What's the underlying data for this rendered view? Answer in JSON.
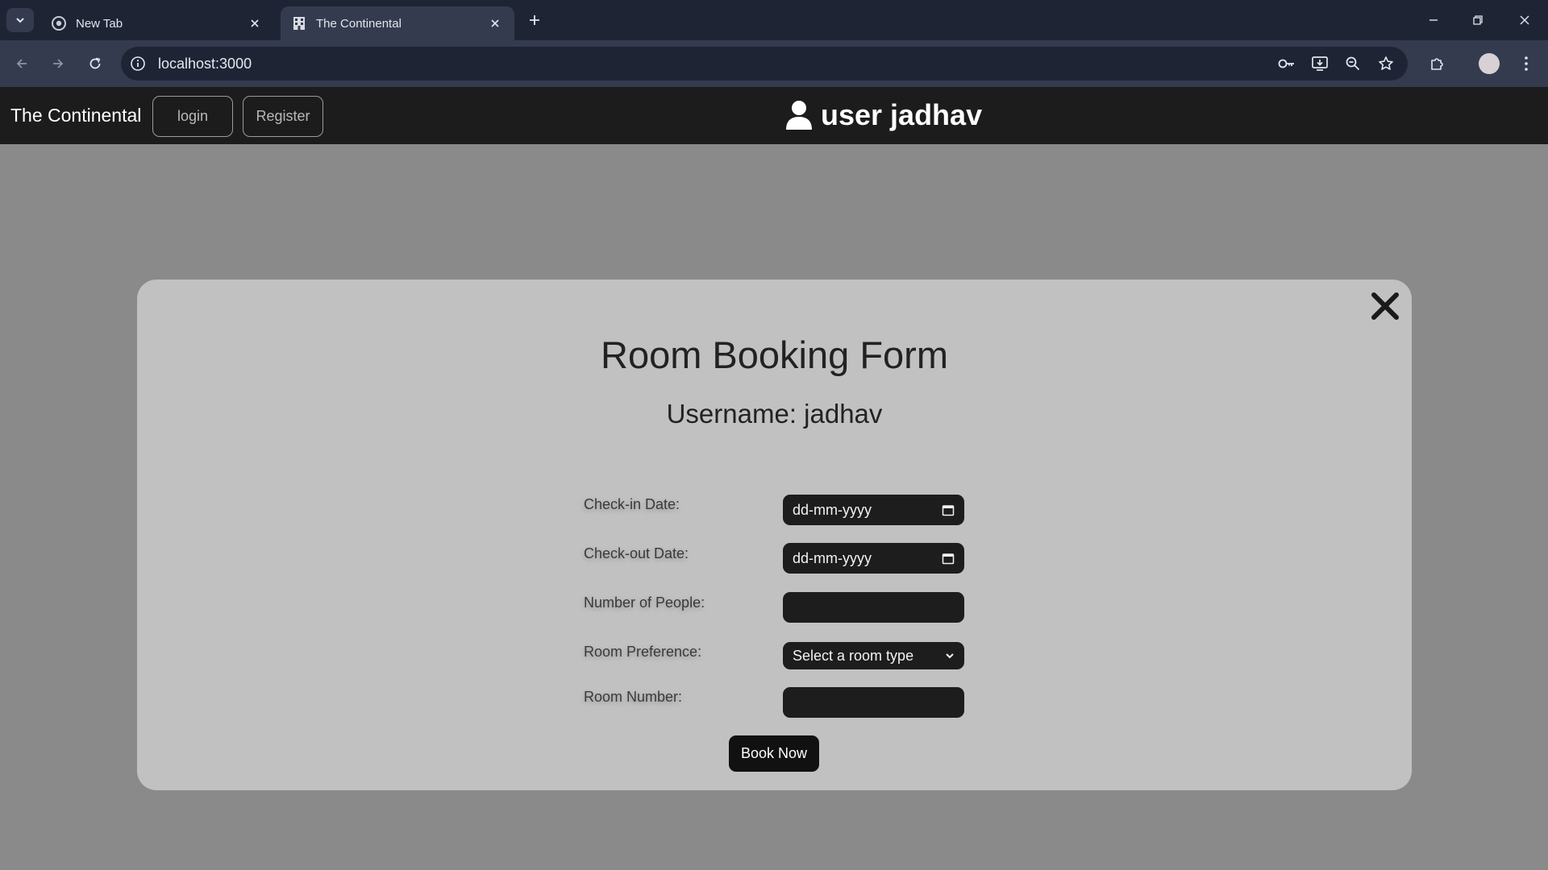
{
  "browser": {
    "tabs": [
      {
        "title": "New Tab",
        "active": false
      },
      {
        "title": "The Continental",
        "active": true
      }
    ],
    "url": "localhost:3000"
  },
  "navbar": {
    "brand": "The Continental",
    "login_label": "login",
    "register_label": "Register",
    "user_label": "user jadhav"
  },
  "modal": {
    "title": "Room Booking Form",
    "subtitle": "Username: jadhav",
    "fields": [
      {
        "label": "Check-in Date:",
        "value": "dd-mm-yyyy",
        "kind": "date"
      },
      {
        "label": "Check-out Date:",
        "value": "dd-mm-yyyy",
        "kind": "date"
      },
      {
        "label": "Number of People:",
        "value": "",
        "kind": "number"
      },
      {
        "label": "Room Preference:",
        "value": "Select a room type",
        "kind": "select"
      },
      {
        "label": "Room Number:",
        "value": "",
        "kind": "text"
      }
    ],
    "submit_label": "Book Now"
  }
}
